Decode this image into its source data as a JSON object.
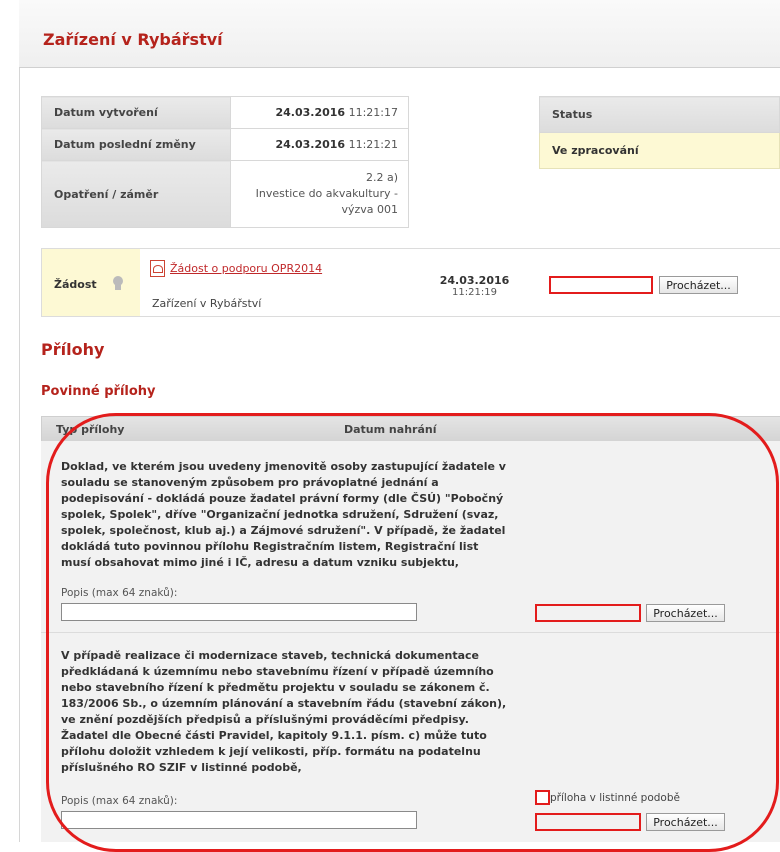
{
  "header": {
    "title": "Zařízení v Rybářství"
  },
  "info": {
    "rows": [
      {
        "label": "Datum vytvoření",
        "date": "24.03.2016",
        "time": "11:21:17"
      },
      {
        "label": "Datum poslední změny",
        "date": "24.03.2016",
        "time": "11:21:21"
      }
    ],
    "measure": {
      "label": "Opatření / záměr",
      "line1": "2.2 a)",
      "line2": "Investice do akvakultury -",
      "line3": "výzva 001"
    }
  },
  "status": {
    "label": "Status",
    "value": "Ve zpracování"
  },
  "application": {
    "label": "Žádost",
    "link": "Žádost o podporu OPR2014",
    "subtitle": "Zařízení v Rybářství",
    "date": "24.03.2016",
    "time": "11:21:19",
    "browse_label": "Procházet..."
  },
  "attachments": {
    "title": "Přílohy",
    "mandatory_title": "Povinné přílohy",
    "columns": {
      "type": "Typ přílohy",
      "date": "Datum nahrání"
    },
    "items": [
      {
        "text": "Doklad, ve kterém jsou uvedeny jmenovitě osoby zastupující žadatele v souladu se stanoveným způsobem pro právoplatné jednání a podepisování - dokládá pouze žadatel právní formy (dle ČSÚ) \"Pobočný spolek, Spolek\", dříve \"Organizační jednotka sdružení, Sdružení (svaz, spolek, společnost, klub aj.) a Zájmové sdružení\". V případě, že žadatel dokládá tuto povinnou přílohu Registračním listem, Registrační list musí obsahovat mimo jiné i IČ, adresu a datum vzniku subjektu,",
        "desc_label": "Popis (max 64 znaků):",
        "browse_label": "Procházet..."
      },
      {
        "text": "V případě realizace či modernizace staveb, technická dokumentace předkládaná k územnímu nebo stavebnímu řízení v případě územního nebo stavebního řízení k předmětu projektu v souladu se zákonem č. 183/2006 Sb., o územním plánování a stavebním řádu (stavební zákon), ve znění pozdějších předpisů a příslušnými prováděcími předpisy. Žadatel dle Obecné části Pravidel, kapitoly 9.1.1. písm. c) může tuto přílohu doložit vzhledem k její velikosti, příp. formátu na podatelnu příslušného RO SZIF v listinné podobě,",
        "desc_label": "Popis (max 64 znaků):",
        "paper_label": "příloha v listinné podobě",
        "browse_label": "Procházet..."
      }
    ]
  },
  "colors": {
    "accent": "#b5231c",
    "highlight": "#e31c1c",
    "status_bg": "#fdf9d4"
  }
}
